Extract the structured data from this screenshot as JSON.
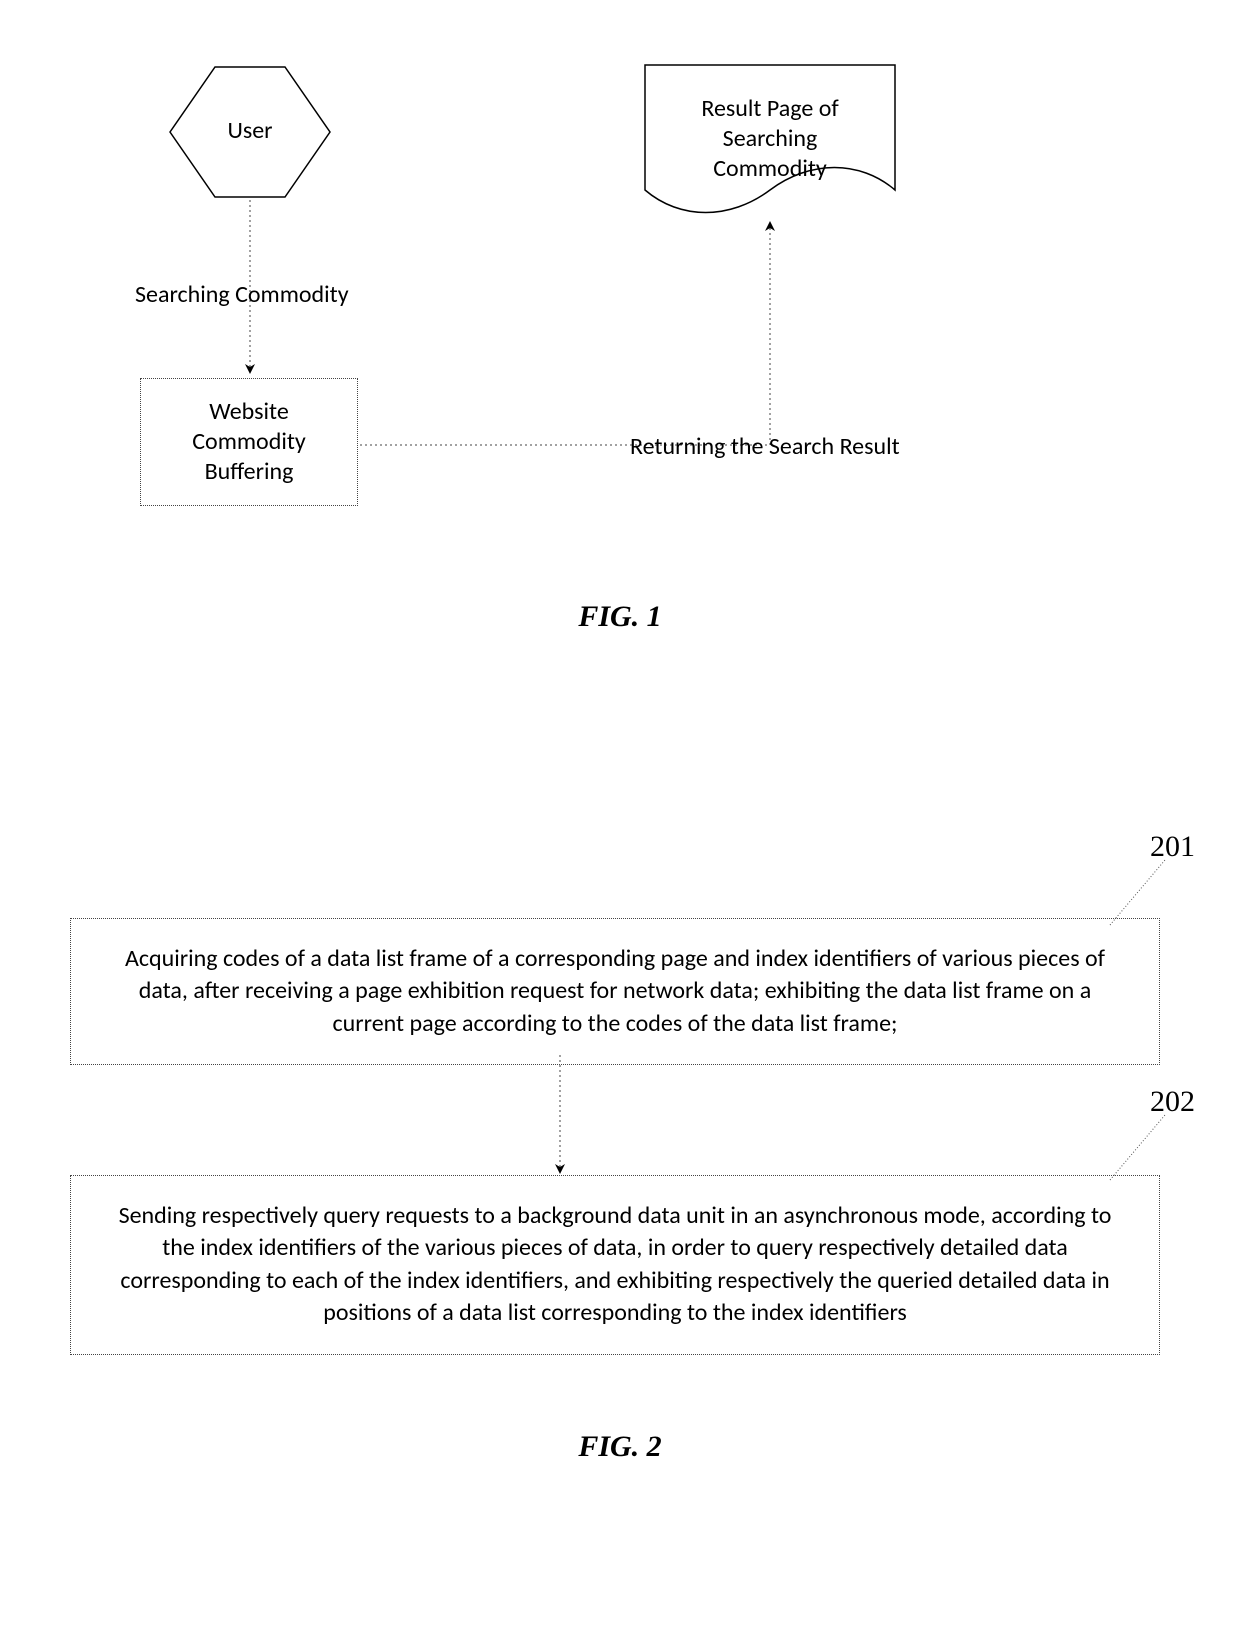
{
  "fig1": {
    "user_label": "User",
    "buffer_label": "Website\nCommodity\nBuffering",
    "result_label": "Result Page of\nSearching\nCommodity",
    "arrow_search_label": "Searching Commodity",
    "arrow_return_label": "Returning the Search Result",
    "caption": "FIG. 1"
  },
  "fig2": {
    "step1_num": "201",
    "step1_text": "Acquiring codes of a data list frame of a corresponding page and index identifiers of various pieces of data, after receiving a page exhibition request for network data; exhibiting the data list frame on a current page according to the codes of the data list frame;",
    "step2_num": "202",
    "step2_text": "Sending respectively query requests to a background data unit in an asynchronous mode, according to the index identifiers of the various pieces of data, in order to query respectively detailed data corresponding to each of the index identifiers, and exhibiting respectively the queried detailed data in positions of a data list corresponding to the index identifiers",
    "caption": "FIG. 2"
  }
}
